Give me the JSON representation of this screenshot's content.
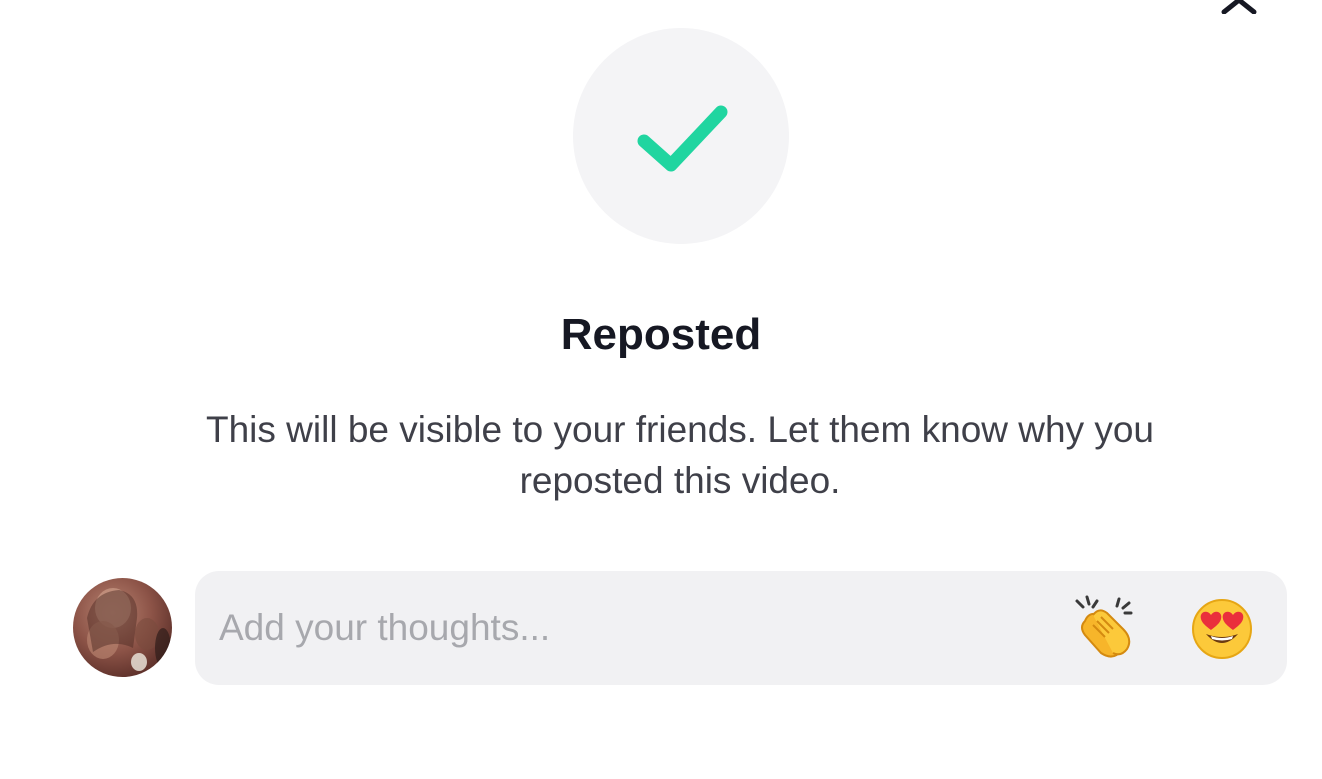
{
  "dialog": {
    "title": "Reposted",
    "description": "This will be visible to your friends. Let them know why you reposted this video.",
    "status_icon": "checkmark-icon",
    "accent_color": "#20d5a0",
    "close_icon": "close-icon"
  },
  "composer": {
    "placeholder": "Add your thoughts...",
    "value": "",
    "quick_emojis": [
      {
        "name": "clapping-hands-emoji"
      },
      {
        "name": "heart-eyes-emoji"
      }
    ]
  },
  "user": {
    "avatar": "avatar-photo"
  }
}
